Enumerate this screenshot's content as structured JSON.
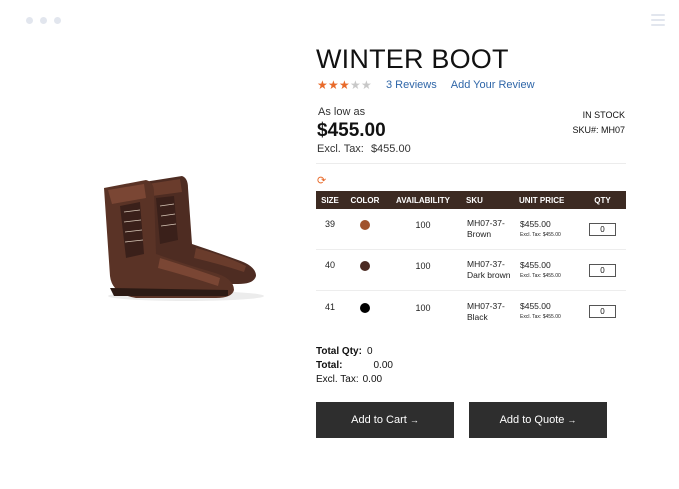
{
  "product": {
    "title": "WINTER BOOT",
    "rating": {
      "value": 3,
      "max": 5
    },
    "reviews_label": "3 Reviews",
    "add_review_label": "Add Your Review",
    "as_low_as_label": "As low as",
    "price": "$455.00",
    "excl_tax_label": "Excl. Tax:",
    "excl_tax_value": "$455.00",
    "stock_status": "IN STOCK",
    "sku_label": "SKU#: MH07"
  },
  "table": {
    "headers": [
      "SIZE",
      "COLOR",
      "AVAILABILITY",
      "SKU",
      "UNIT PRICE",
      "QTY"
    ],
    "rows": [
      {
        "size": "39",
        "color": "#a0522d",
        "availability": "100",
        "sku_line1": "MH07-37-",
        "sku_line2": "Brown",
        "price": "$455.00",
        "tax": "Excl. Tax: $455.00",
        "qty": "0"
      },
      {
        "size": "40",
        "color": "#4a2a22",
        "availability": "100",
        "sku_line1": "MH07-37-",
        "sku_line2": "Dark brown",
        "price": "$455.00",
        "tax": "Excl. Tax: $455.00",
        "qty": "0"
      },
      {
        "size": "41",
        "color": "#000000",
        "availability": "100",
        "sku_line1": "MH07-37-",
        "sku_line2": "Black",
        "price": "$455.00",
        "tax": "Excl. Tax: $455.00",
        "qty": "0"
      }
    ]
  },
  "totals": {
    "total_qty_label": "Total Qty:",
    "total_qty_value": "0",
    "total_label": "Total:",
    "total_value": "0.00",
    "excl_tax_label": "Excl. Tax:",
    "excl_tax_value": "0.00"
  },
  "actions": {
    "add_to_cart": "Add to Cart",
    "add_to_quote": "Add to Quote",
    "arrow_icon": "arrow-right-icon"
  },
  "colors": {
    "accent": "#e86a2a",
    "link": "#2f66a8",
    "table_header": "#3c2a22",
    "button": "#2e2e2e"
  }
}
